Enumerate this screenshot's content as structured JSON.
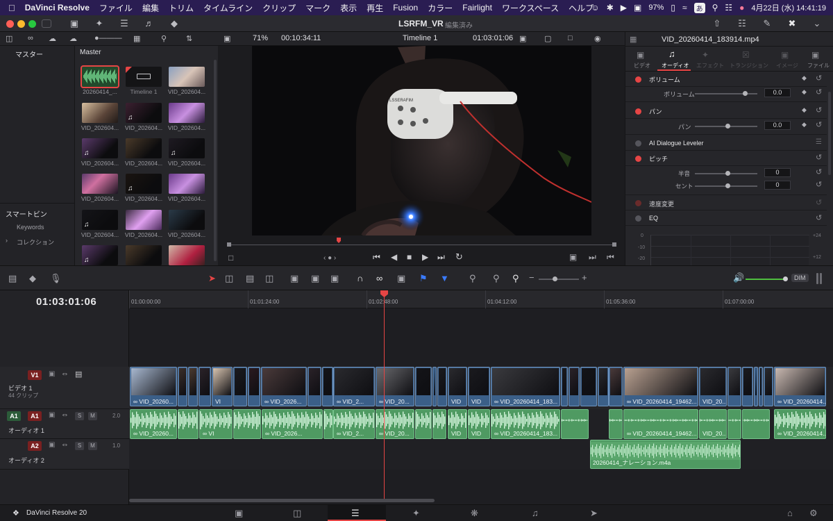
{
  "menubar": {
    "app": "DaVinci Resolve",
    "items": [
      "ファイル",
      "編集",
      "トリム",
      "タイムライン",
      "クリップ",
      "マーク",
      "表示",
      "再生",
      "Fusion",
      "カラー",
      "Fairlight",
      "ワークスペース",
      "ヘルプ"
    ],
    "battery": "97%",
    "input_method": "あ",
    "datetime": "4月22日 (水)  14:41:19"
  },
  "window": {
    "project_name": "LSRFM_VR",
    "project_state": "編集済み"
  },
  "viewer_toolbar": {
    "zoom": "71%",
    "source_timecode": "00:10:34:11",
    "timeline_name": "Timeline 1",
    "record_timecode": "01:03:01:06"
  },
  "media_pool": {
    "master_label": "マスター",
    "pool_label": "Master",
    "smart_bins_label": "スマートビン",
    "smart_bins": [
      "Keywords",
      "コレクション"
    ],
    "clips": [
      {
        "name": "20260414_...",
        "kind": "audio"
      },
      {
        "name": "Timeline 1",
        "kind": "timeline"
      },
      {
        "name": "VID_202604...",
        "kind": "video"
      },
      {
        "name": "VID_202604...",
        "kind": "video"
      },
      {
        "name": "VID_202604...",
        "kind": "video"
      },
      {
        "name": "VID_202604...",
        "kind": "video"
      },
      {
        "name": "VID_202604...",
        "kind": "video"
      },
      {
        "name": "VID_202604...",
        "kind": "video"
      },
      {
        "name": "VID_202604...",
        "kind": "video"
      },
      {
        "name": "VID_202604...",
        "kind": "video"
      },
      {
        "name": "VID_202604...",
        "kind": "video"
      },
      {
        "name": "VID_202604...",
        "kind": "video"
      },
      {
        "name": "VID_202604...",
        "kind": "video"
      },
      {
        "name": "VID_202604...",
        "kind": "video"
      },
      {
        "name": "VID_202604...",
        "kind": "video"
      },
      {
        "name": "",
        "kind": "video"
      },
      {
        "name": "",
        "kind": "video"
      },
      {
        "name": "",
        "kind": "video"
      }
    ]
  },
  "video_overlay": {
    "headset_text": "LSSERAFIM"
  },
  "inspector": {
    "file_name": "VID_20260414_183914.mp4",
    "tabs": [
      "ビデオ",
      "オーディオ",
      "エフェクト",
      "トランジション",
      "イメージ",
      "ファイル"
    ],
    "active_tab": "オーディオ",
    "sections": {
      "volume": {
        "title": "ボリューム",
        "param": "ボリューム",
        "value": "0.0"
      },
      "pan": {
        "title": "パン",
        "param": "パン",
        "value": "0.0"
      },
      "dialogue": {
        "title": "AI Dialogue Leveler"
      },
      "pitch": {
        "title": "ピッチ",
        "semitone_label": "半音",
        "semitone_value": "0",
        "cent_label": "セント",
        "cent_value": "0"
      },
      "speed": {
        "title": "速度変更"
      },
      "eq": {
        "title": "EQ",
        "scale": [
          "0",
          "-10",
          "-20"
        ],
        "scale_right": [
          "+24",
          "+12"
        ]
      }
    }
  },
  "timeline": {
    "current_timecode": "01:03:01:06",
    "ruler": [
      "01:00:00:00",
      "01:01:24:00",
      "01:02:48:00",
      "01:04:12:00",
      "01:05:36:00",
      "01:07:00:00"
    ],
    "dim_label": "DIM",
    "tracks": {
      "v1": {
        "tag": "V1",
        "name": "ビデオ 1",
        "count": "44 クリップ"
      },
      "a1": {
        "tag": "A1",
        "name": "オーディオ 1",
        "level": "2.0"
      },
      "a2": {
        "tag": "A2",
        "name": "オーディオ 2",
        "level": "1.0"
      }
    },
    "clip_labels": {
      "c1": "VID_20260...",
      "c2": "VI",
      "c3": "VID_2026...",
      "c4": "VID_2...",
      "c5": "VID_20...",
      "c6": "VID",
      "c7": "VID_20260414_183...",
      "c8": "VID_20260414_19462...",
      "c9": "VID_20260414..."
    },
    "audio_clip_a2": "20260414_ナレーション.m4a"
  },
  "bottom": {
    "brand": "DaVinci Resolve 20"
  },
  "colors": {
    "accent_red": "#e64545",
    "video_clip": "#3b5f88",
    "audio_clip": "#4f9a62",
    "menubar_bg": "#2a1d52"
  }
}
